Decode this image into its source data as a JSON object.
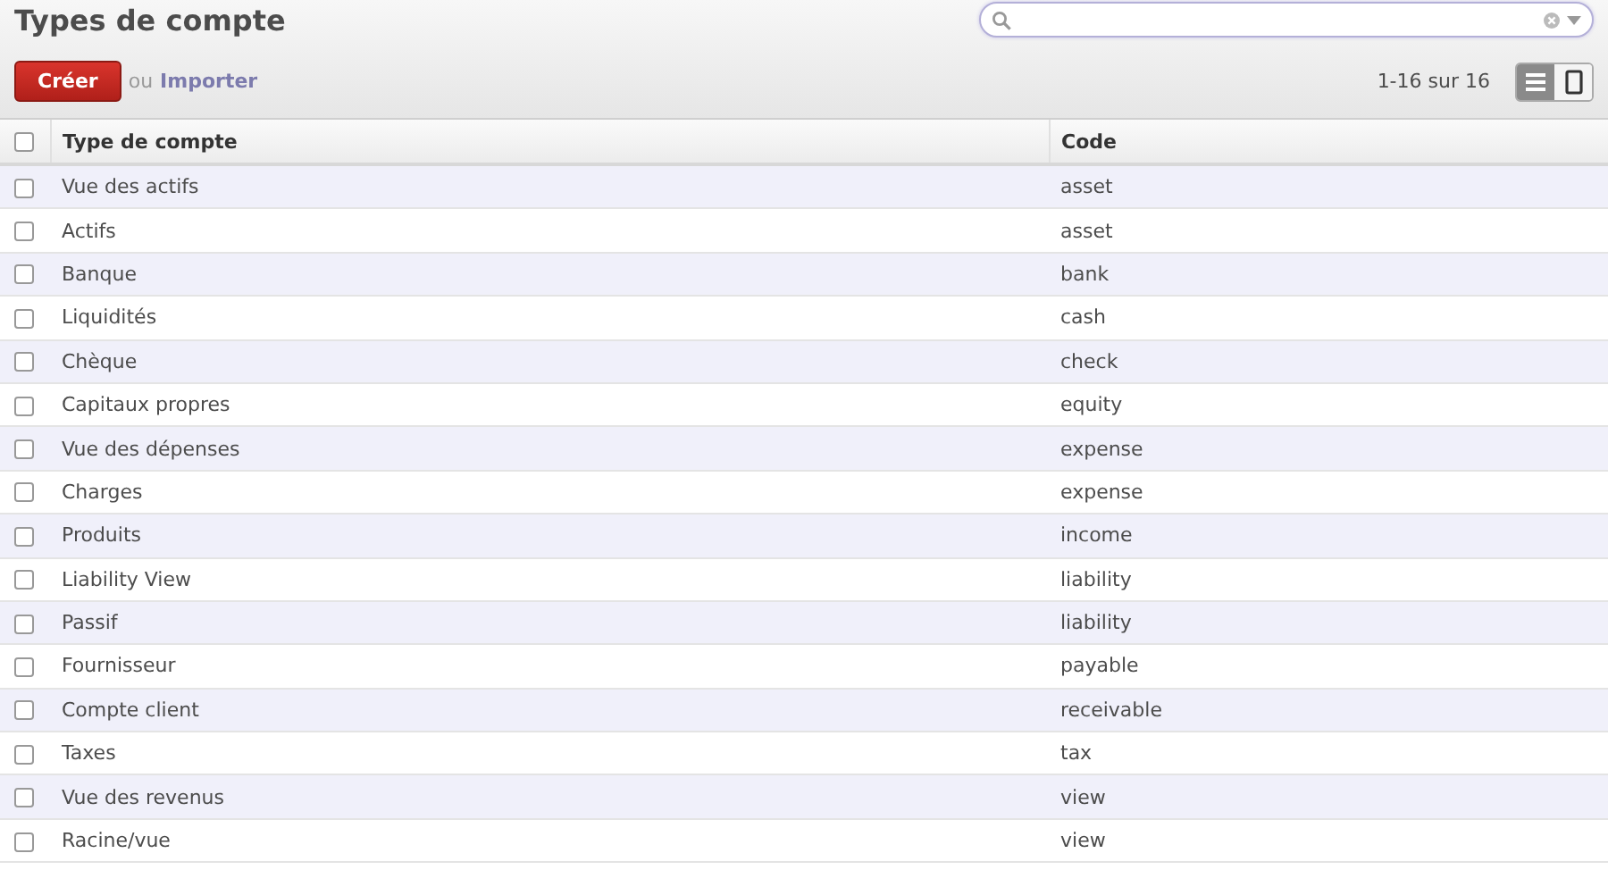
{
  "page": {
    "title": "Types de compte"
  },
  "actions": {
    "create": "Créer",
    "separator": "ou",
    "import": "Importer"
  },
  "pager": "1-16 sur 16",
  "views": [
    {
      "kind": "list",
      "selected": true
    },
    {
      "kind": "form",
      "selected": false
    }
  ],
  "table": {
    "columns": [
      "Type de compte",
      "Code"
    ],
    "all_checked": false,
    "rows": [
      {
        "cells": [
          "Vue des actifs",
          "asset"
        ],
        "checked": false
      },
      {
        "cells": [
          "Actifs",
          "asset"
        ],
        "checked": false
      },
      {
        "cells": [
          "Banque",
          "bank"
        ],
        "checked": false
      },
      {
        "cells": [
          "Liquidités",
          "cash"
        ],
        "checked": false
      },
      {
        "cells": [
          "Chèque",
          "check"
        ],
        "checked": false
      },
      {
        "cells": [
          "Capitaux propres",
          "equity"
        ],
        "checked": false
      },
      {
        "cells": [
          "Vue des dépenses",
          "expense"
        ],
        "checked": false
      },
      {
        "cells": [
          "Charges",
          "expense"
        ],
        "checked": false
      },
      {
        "cells": [
          "Produits",
          "income"
        ],
        "checked": false
      },
      {
        "cells": [
          "Liability View",
          "liability"
        ],
        "checked": false
      },
      {
        "cells": [
          "Passif",
          "liability"
        ],
        "checked": false
      },
      {
        "cells": [
          "Fournisseur",
          "payable"
        ],
        "checked": false
      },
      {
        "cells": [
          "Compte client",
          "receivable"
        ],
        "checked": false
      },
      {
        "cells": [
          "Taxes",
          "tax"
        ],
        "checked": false
      },
      {
        "cells": [
          "Vue des revenus",
          "view"
        ],
        "checked": false
      },
      {
        "cells": [
          "Racine/vue",
          "view"
        ],
        "checked": false
      }
    ]
  }
}
